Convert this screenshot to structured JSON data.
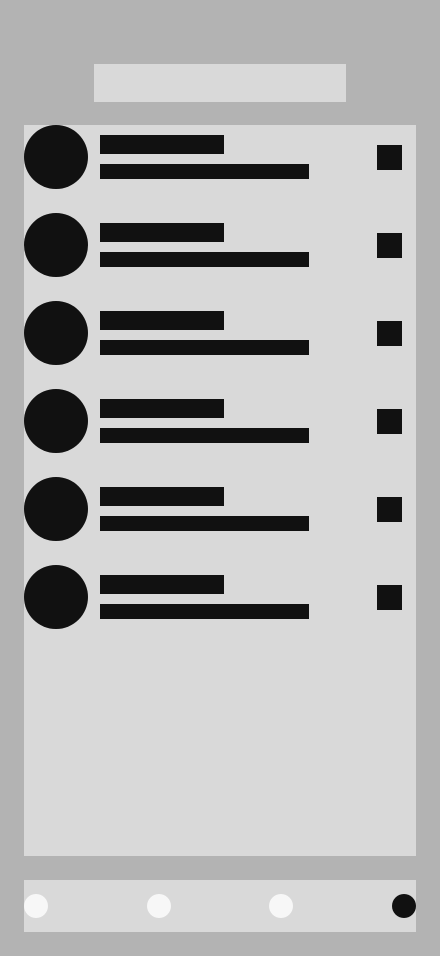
{
  "colors": {
    "background": "#b3b3b3",
    "panel": "#d9d9d9",
    "ink": "#111111",
    "inactive_tab": "#f7f7f7"
  },
  "list": {
    "item_count": 6
  },
  "tabs": {
    "count": 4,
    "active_index": 3
  }
}
